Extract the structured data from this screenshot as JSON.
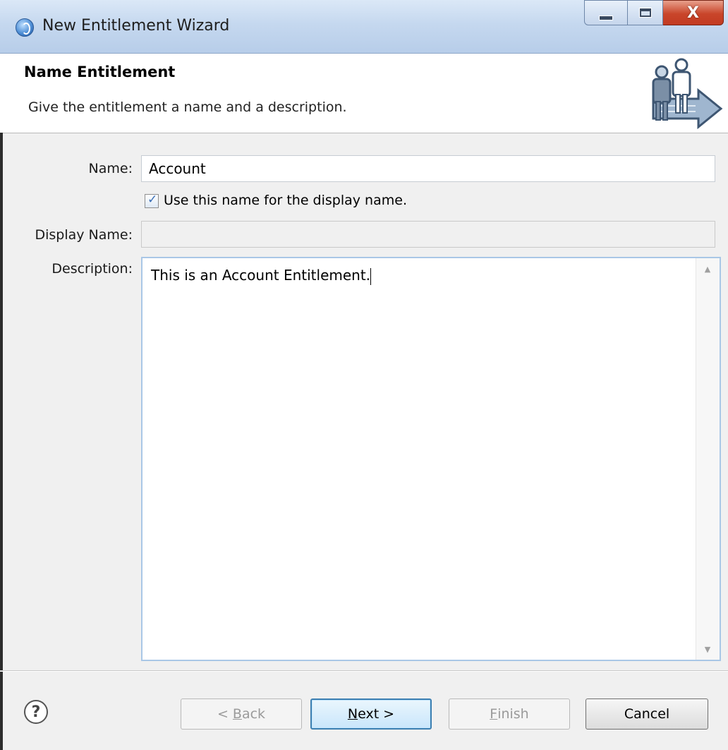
{
  "window": {
    "title": "New Entitlement Wizard",
    "close_glyph": "X"
  },
  "banner": {
    "title": "Name Entitlement",
    "description": "Give the entitlement a name and a description."
  },
  "form": {
    "name_label": "Name:",
    "name_value": "Account",
    "checkbox_label": "Use this name for the display name.",
    "checkbox_checked": true,
    "display_name_label": "Display Name:",
    "display_name_value": "",
    "description_label": "Description:",
    "description_value": "This is an Account Entitlement."
  },
  "buttons": {
    "help": "?",
    "back_prefix": "< ",
    "back_mnemonic": "B",
    "back_rest": "ack",
    "next_mnemonic": "N",
    "next_rest": "ext >",
    "finish_mnemonic": "F",
    "finish_rest": "inish",
    "cancel": "Cancel"
  },
  "icons": {
    "app": "eclipse-wizard-icon",
    "banner": "entitlement-users-arrow-graphic",
    "check": "checkmark-icon"
  },
  "colors": {
    "titlebar": "#c5d8ef",
    "close_button": "#c9452a",
    "primary_button_border": "#3c7fb1",
    "textarea_focus_border": "#a9c7e6"
  }
}
